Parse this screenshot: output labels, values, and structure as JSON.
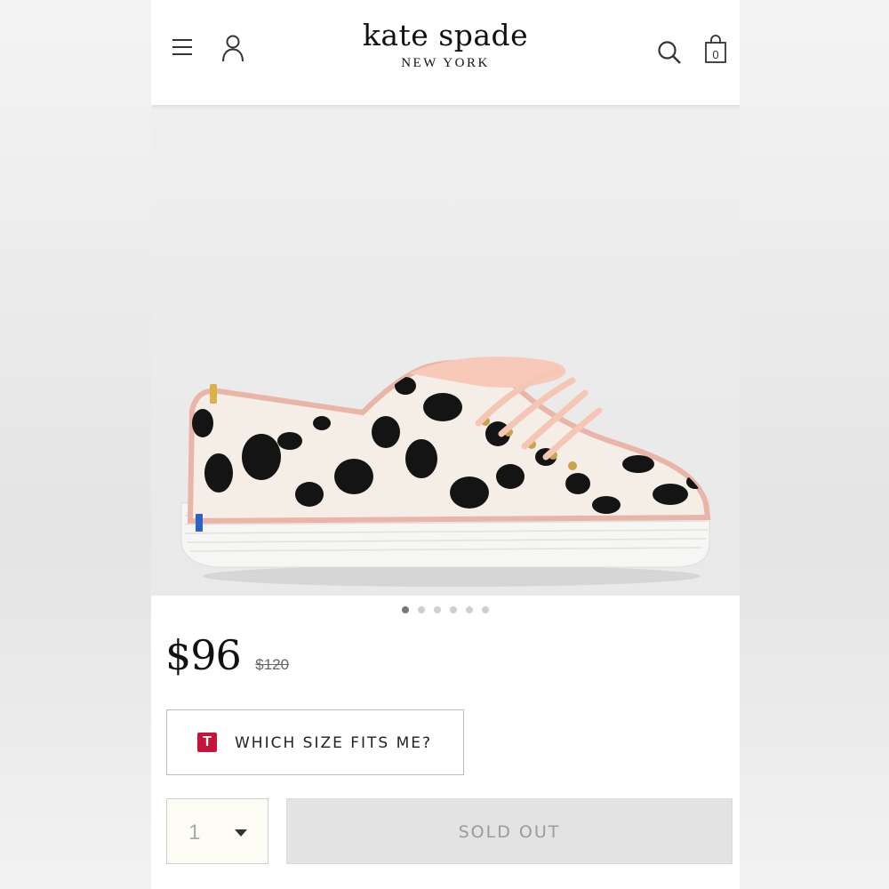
{
  "header": {
    "brand_name": "kate spade",
    "brand_sub": "NEW YORK",
    "cart_count": "0",
    "icons": [
      "menu-icon",
      "user-icon",
      "search-icon",
      "shopping-bag-icon"
    ]
  },
  "product": {
    "image": "dalmatian-spot-platform-sneaker",
    "carousel_total": 6,
    "carousel_active": 1,
    "price_current": "$96",
    "price_original": "$120"
  },
  "fit": {
    "badge": "T",
    "label": "WHICH SIZE FITS ME?"
  },
  "purchase": {
    "quantity": "1",
    "button_label": "SOLD OUT"
  },
  "colors": {
    "fit_badge": "#c5153b",
    "sold_out_bg": "#e3e3e3",
    "sold_out_text": "#9b9b9b"
  }
}
